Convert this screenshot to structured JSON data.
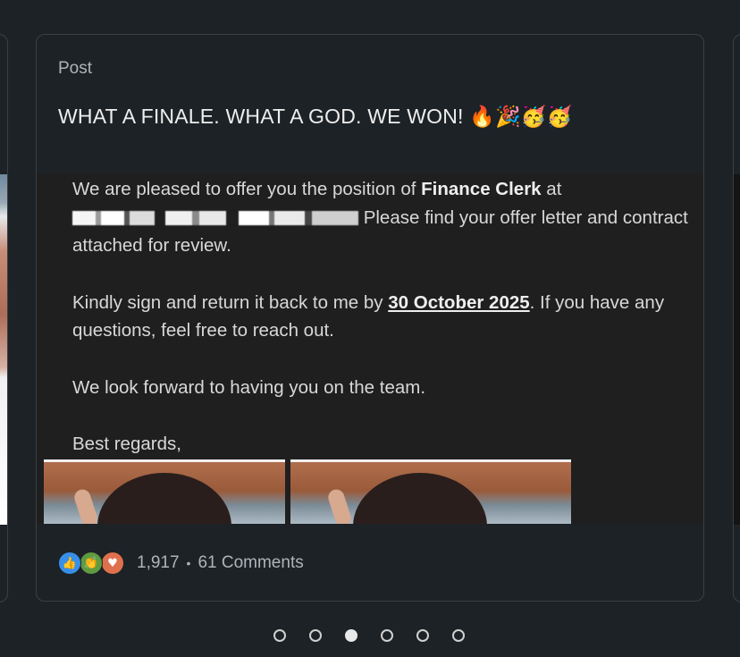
{
  "post": {
    "label": "Post",
    "text": "WHAT A FINALE. WHAT A GOD. WE WON!",
    "emojis": "🔥🎉🥳🥳"
  },
  "letter": {
    "line1_pre": "We are pleased to offer you the position of ",
    "position": "Finance Clerk",
    "line1_post": " at",
    "line2_post": " Please find your offer letter and contract attached for review.",
    "para2_pre": "Kindly sign and return it back to me by ",
    "deadline": "30 October 2025",
    "para2_post": ". If you have any questions, feel free to reach out.",
    "para3": "We look forward to having you on the team.",
    "signoff": "Best regards,"
  },
  "footer": {
    "reaction_icons": [
      "like-icon",
      "clap-icon",
      "heart-icon"
    ],
    "reaction_count": "1,917",
    "separator": "•",
    "comments": "61 Comments"
  },
  "pager": {
    "count": 6,
    "active_index": 2
  },
  "colors": {
    "background": "#1d2226",
    "card_border": "#3c4043",
    "like": "#378fe9",
    "clap": "#5f9b41",
    "love": "#df704d"
  }
}
